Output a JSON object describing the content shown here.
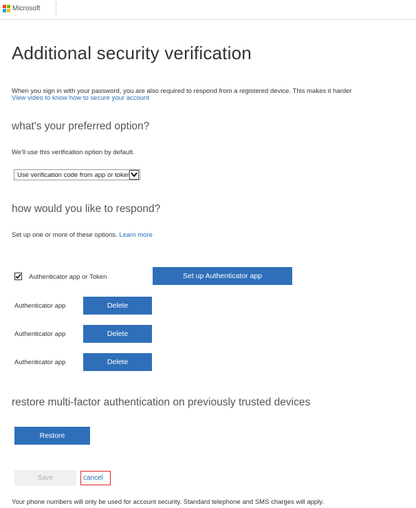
{
  "header": {
    "brand_name": "Microsoft",
    "logo_colors": [
      "#f25022",
      "#7fba00",
      "#00a4ef",
      "#ffb900"
    ]
  },
  "main": {
    "title": "Additional security verification",
    "intro_text": "When you sign in with your password, you are also required to respond from a registered device. This makes it harder",
    "video_link": "View video to know how to secure your account"
  },
  "preferred_option": {
    "heading": "what's your preferred option?",
    "description": "We'll use this verification option by default.",
    "selected_value": "Use verification code from app or token"
  },
  "respond": {
    "heading": "how would you like to respond?",
    "description": "Set up one or more of these options.",
    "learn_more": "Learn more",
    "authenticator_checkbox_label": "Authenticator app or Token",
    "authenticator_checked": true,
    "setup_button": "Set up Authenticator app",
    "apps": [
      {
        "label": "Authenticator app",
        "delete_label": "Delete"
      },
      {
        "label": "Authenticator app",
        "delete_label": "Delete"
      },
      {
        "label": "Authenticator app",
        "delete_label": "Delete"
      }
    ]
  },
  "restore": {
    "heading": "restore multi-factor authentication on previously trusted devices",
    "button": "Restore"
  },
  "actions": {
    "save": "Save",
    "cancel": "cancel"
  },
  "footer": {
    "note": "Your phone numbers will only be used for account security. Standard telephone and SMS charges will apply."
  },
  "colors": {
    "primary_button": "#2f6fba",
    "link": "#2a6eb8",
    "highlight": "#e02020"
  }
}
